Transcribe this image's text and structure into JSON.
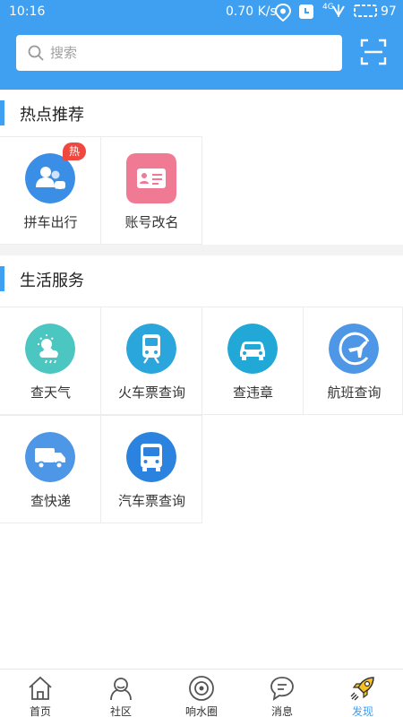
{
  "status_bar": {
    "time": "10:16",
    "speed": "0.70 K/s",
    "network": "4G",
    "battery": "97"
  },
  "search": {
    "placeholder": "搜索"
  },
  "hot": {
    "title": "热点推荐",
    "items": [
      {
        "label": "拼车出行",
        "badge": "热",
        "icon": "carpool-people-icon",
        "color": "#3a8ee6"
      },
      {
        "label": "账号改名",
        "icon": "id-card-icon",
        "color": "#f07a93"
      }
    ]
  },
  "life": {
    "title": "生活服务",
    "items": [
      {
        "label": "查天气",
        "icon": "weather-icon",
        "color": "#4cc6c0"
      },
      {
        "label": "火车票查询",
        "icon": "train-icon",
        "color": "#2aa6dc"
      },
      {
        "label": "查违章",
        "icon": "car-icon",
        "color": "#21a8d6"
      },
      {
        "label": "航班查询",
        "icon": "airplane-icon",
        "color": "#4e97e6"
      },
      {
        "label": "查快递",
        "icon": "delivery-truck-icon",
        "color": "#4e97e6"
      },
      {
        "label": "汽车票查询",
        "icon": "bus-icon",
        "color": "#2b83df"
      }
    ]
  },
  "nav": {
    "items": [
      {
        "label": "首页",
        "icon": "home-icon"
      },
      {
        "label": "社区",
        "icon": "community-icon"
      },
      {
        "label": "响水圈",
        "icon": "circle-icon"
      },
      {
        "label": "消息",
        "icon": "message-icon"
      },
      {
        "label": "发现",
        "icon": "rocket-icon",
        "active": true
      }
    ]
  },
  "colors": {
    "primary": "#3f9ff0",
    "badge": "#f0483e"
  }
}
